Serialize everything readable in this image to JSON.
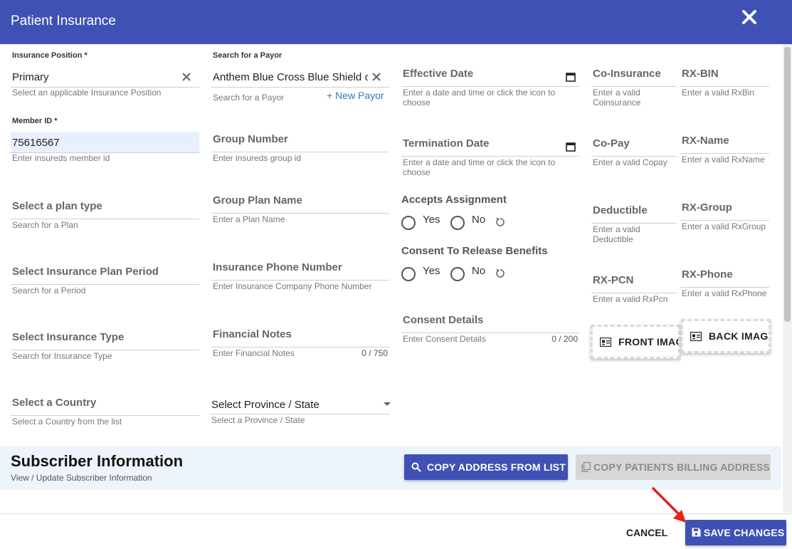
{
  "dialog": {
    "title": "Patient Insurance",
    "close_icon": "close-icon"
  },
  "col1": {
    "insurance_position": {
      "label": "Insurance Position *",
      "value": "Primary",
      "hint": "Select an applicable Insurance Position"
    },
    "member_id": {
      "label": "Member ID *",
      "value": "75616567",
      "hint": "Enter insureds member id"
    },
    "plan_type": {
      "label": "Select a plan type",
      "hint": "Search for a Plan"
    },
    "plan_period": {
      "label": "Select Insurance Plan Period",
      "hint": "Search for a Period"
    },
    "insurance_type": {
      "label": "Select Insurance Type",
      "hint": "Search for Insurance Type"
    },
    "country": {
      "label": "Select a Country",
      "hint": "Select a Country from the list"
    }
  },
  "col2": {
    "payor": {
      "label": "Search for a Payor",
      "value": "Anthem Blue Cross Blue Shield o",
      "hint": "Search for a Payor",
      "new_payor": "+ New Payor"
    },
    "group_number": {
      "label": "Group Number",
      "hint": "Enter insureds group id"
    },
    "group_plan_name": {
      "label": "Group Plan Name",
      "hint": "Enter a Plan Name"
    },
    "insurance_phone": {
      "label": "Insurance Phone Number",
      "hint": "Enter Insurance Company Phone Number"
    },
    "financial_notes": {
      "label": "Financial Notes",
      "hint": "Enter Financial Notes",
      "counter": "0 / 750"
    },
    "province": {
      "value": "Select Province / State",
      "hint": "Select a Province / State"
    }
  },
  "col3": {
    "effective_date": {
      "label": "Effective Date",
      "hint": "Enter a date and time or click the icon to choose"
    },
    "termination_date": {
      "label": "Termination Date",
      "hint": "Enter a date and time or click the icon to choose"
    },
    "accepts_assignment": {
      "label": "Accepts Assignment",
      "yes": "Yes",
      "no": "No"
    },
    "consent_release": {
      "label": "Consent To Release Benefits",
      "yes": "Yes",
      "no": "No"
    },
    "consent_details": {
      "label": "Consent Details",
      "hint": "Enter Consent Details",
      "counter": "0 / 200"
    }
  },
  "col4": {
    "co_insurance": {
      "label": "Co-Insurance",
      "hint": "Enter a valid Coinsurance"
    },
    "co_pay": {
      "label": "Co-Pay",
      "hint": "Enter a valid Copay"
    },
    "deductible": {
      "label": "Deductible",
      "hint": "Enter a valid Deductible"
    },
    "rx_pcn": {
      "label": "RX-PCN",
      "hint": "Enter a valid RxPcn"
    },
    "front_image": "FRONT IMAGE"
  },
  "col5": {
    "rx_bin": {
      "label": "RX-BIN",
      "hint": "Enter a valid RxBin"
    },
    "rx_name": {
      "label": "RX-Name",
      "hint": "Enter a valid RxName"
    },
    "rx_group": {
      "label": "RX-Group",
      "hint": "Enter a valid RxGroup"
    },
    "rx_phone": {
      "label": "RX-Phone",
      "hint": "Enter a valid RxPhone"
    },
    "back_image": "BACK IMAGE"
  },
  "subscriber": {
    "heading": "Subscriber Information",
    "subheading": "View / Update Subscriber Information",
    "copy_address": "COPY ADDRESS FROM LIST",
    "copy_billing": "COPY PATIENTS BILLING ADDRESS"
  },
  "footer": {
    "cancel": "CANCEL",
    "save": "SAVE CHANGES"
  },
  "colors": {
    "primary": "#3f51b5",
    "autofill": "#e8f0fe",
    "disabled": "#d7d7d7",
    "arrow": "#e8201a"
  }
}
